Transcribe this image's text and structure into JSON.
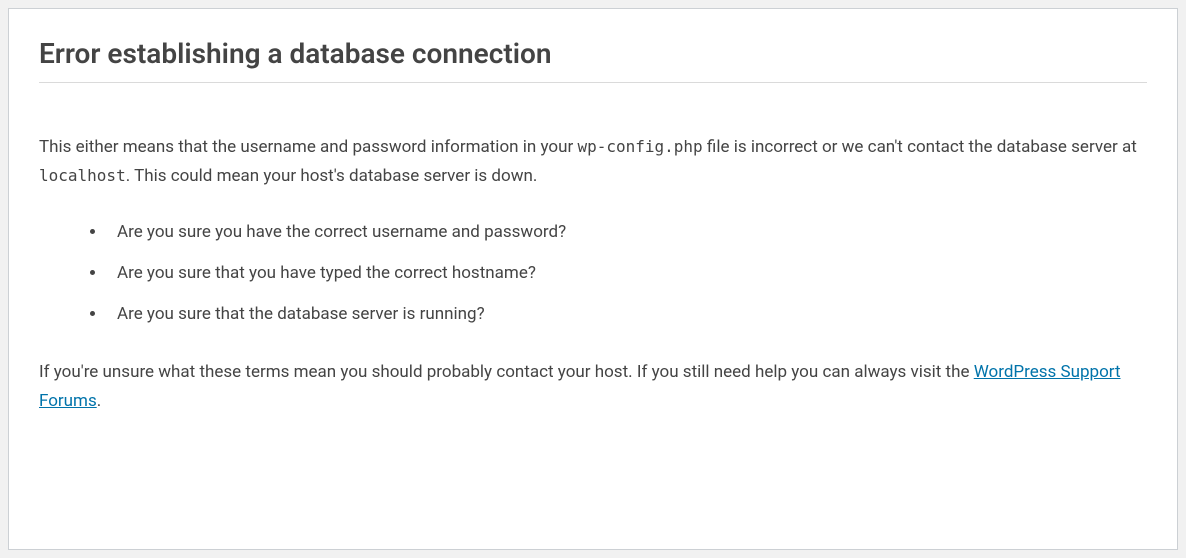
{
  "title": "Error establishing a database connection",
  "intro": {
    "part1": "This either means that the username and password information in your ",
    "code1": "wp-config.php",
    "part2": " file is incorrect or we can't contact the database server at ",
    "code2": "localhost",
    "part3": ". This could mean your host's database server is down."
  },
  "checks": [
    "Are you sure you have the correct username and password?",
    "Are you sure that you have typed the correct hostname?",
    "Are you sure that the database server is running?"
  ],
  "footer": {
    "part1": "If you're unsure what these terms mean you should probably contact your host. If you still need help you can always visit the ",
    "linkText": "WordPress Support Forums",
    "part2": "."
  }
}
